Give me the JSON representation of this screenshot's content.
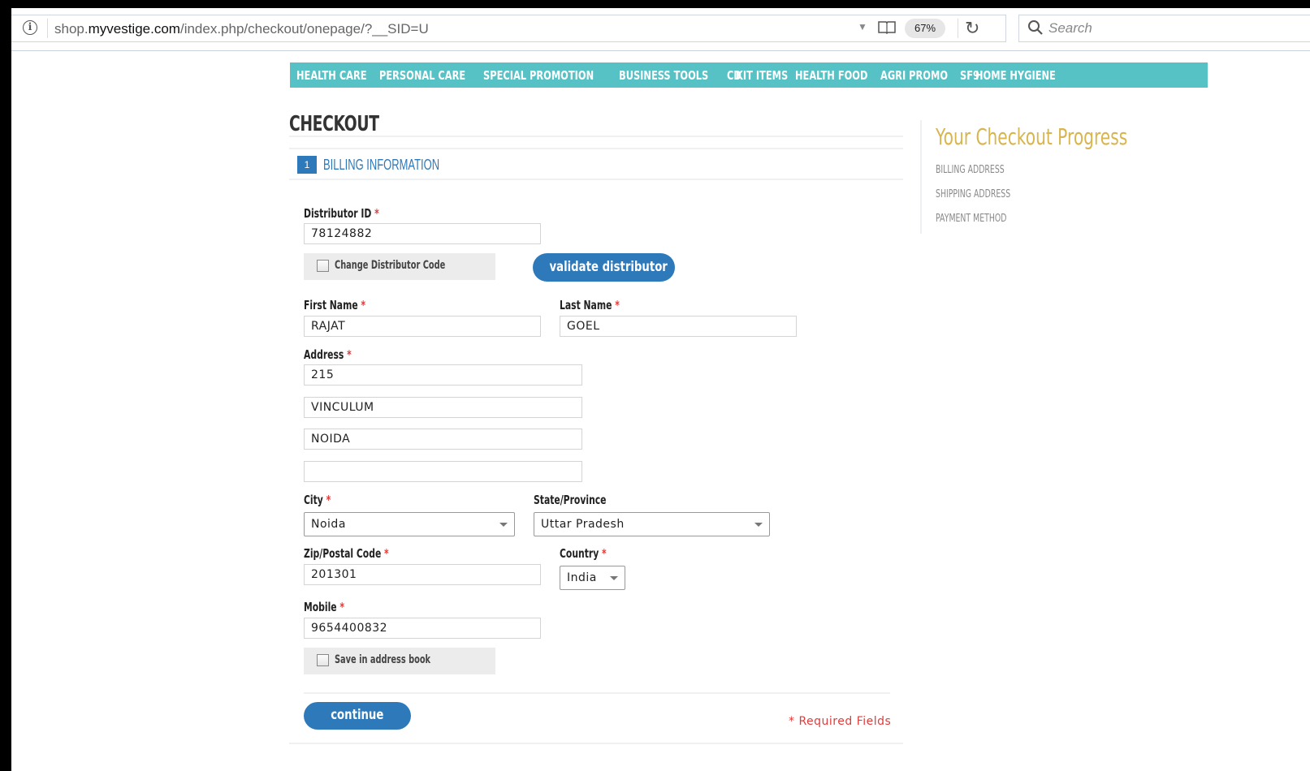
{
  "browser": {
    "url_prefix": "shop.",
    "url_domain": "myvestige.com",
    "url_path": "/index.php/checkout/onepage/?__SID=U",
    "zoom": "67%",
    "search_placeholder": "Search"
  },
  "nav": {
    "items": [
      "HEALTH CARE",
      "PERSONAL CARE",
      "SPECIAL PROMOTION",
      "BUSINESS TOOLS",
      "CD",
      "KIT ITEMS",
      "HEALTH FOOD",
      "AGRI PROMO",
      "SF9",
      "HOME HYGIENE"
    ]
  },
  "checkout": {
    "title": "CHECKOUT",
    "step_number": "1",
    "step_title": "BILLING INFORMATION"
  },
  "form": {
    "distributor_id_label": "Distributor ID",
    "distributor_id": "78124882",
    "change_code_label": "Change Distributor Code",
    "validate_button": "validate distributor",
    "first_name_label": "First Name",
    "first_name": "RAJAT",
    "last_name_label": "Last Name",
    "last_name": "GOEL",
    "address_label": "Address",
    "address_lines": [
      "215",
      "VINCULUM",
      "NOIDA",
      ""
    ],
    "city_label": "City",
    "city": "Noida",
    "state_label": "State/Province",
    "state": "Uttar Pradesh",
    "zip_label": "Zip/Postal Code",
    "zip": "201301",
    "country_label": "Country",
    "country": "India",
    "mobile_label": "Mobile",
    "mobile": "9654400832",
    "save_address_label": "Save in address book",
    "continue_button": "continue",
    "required_note": "* Required Fields",
    "required_marker": "*"
  },
  "progress": {
    "title": "Your Checkout Progress",
    "items": [
      "BILLING ADDRESS",
      "SHIPPING ADDRESS",
      "PAYMENT METHOD"
    ]
  },
  "colors": {
    "nav_bg": "#57c2c6",
    "accent_blue": "#2e79b9",
    "required_red": "#e03b3b",
    "progress_gold": "#d8b54e"
  }
}
